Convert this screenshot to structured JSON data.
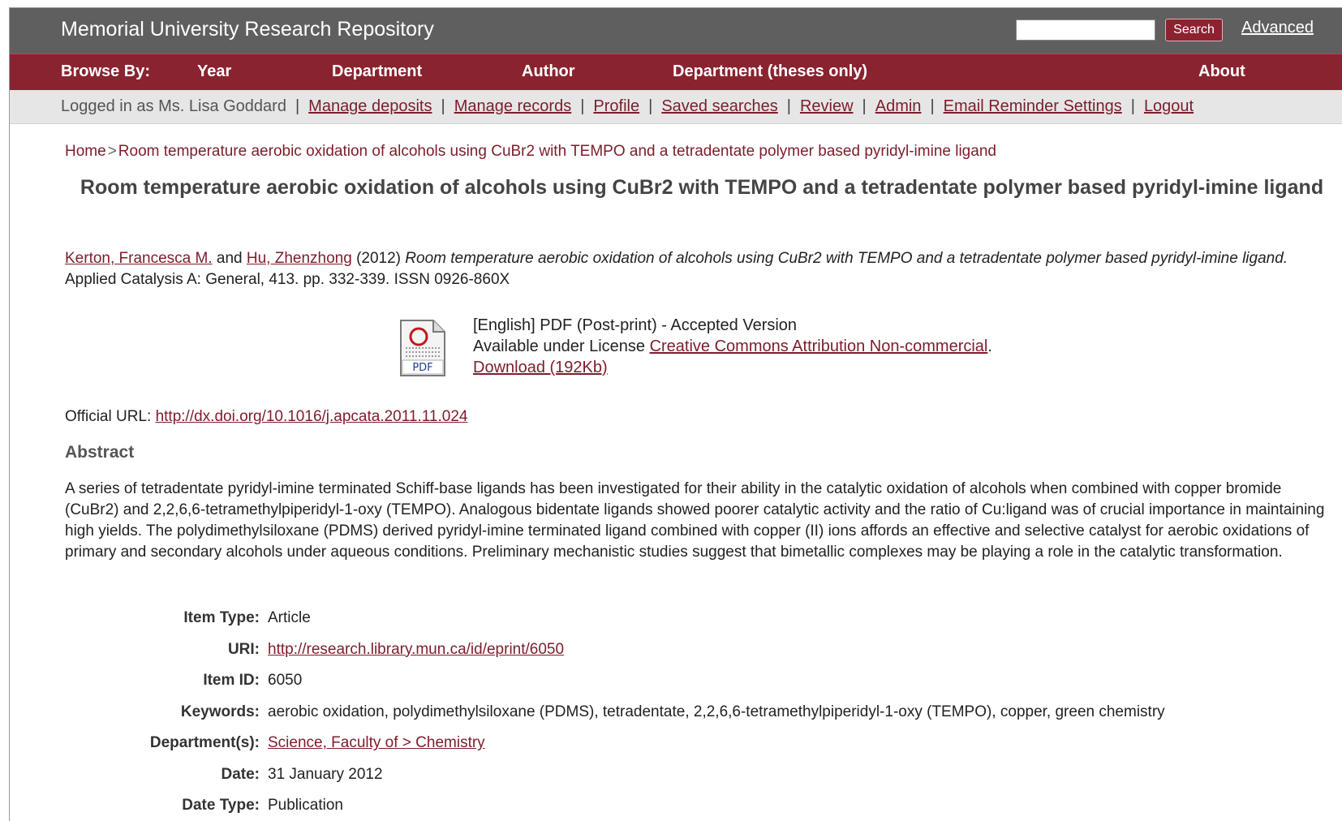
{
  "header": {
    "site_title": "Memorial University Research Repository",
    "search_button": "Search",
    "search_value": "",
    "advanced_link": "Advanced"
  },
  "browse": {
    "label": "Browse By:",
    "items": [
      "Year",
      "Department",
      "Author",
      "Department (theses only)"
    ],
    "about": "About"
  },
  "userbar": {
    "logged_in": "Logged in as Ms. Lisa Goddard",
    "links": [
      "Manage deposits",
      "Manage records",
      "Profile",
      "Saved searches",
      "Review",
      "Admin",
      "Email Reminder Settings",
      "Logout"
    ]
  },
  "breadcrumb": {
    "home": "Home",
    "separator": ">",
    "current": "Room temperature aerobic oxidation of alcohols using CuBr2 with TEMPO and a tetradentate polymer based pyridyl-imine ligand"
  },
  "item": {
    "title": "Room temperature aerobic oxidation of alcohols using CuBr2 with TEMPO and a tetradentate polymer based pyridyl-imine ligand",
    "citation": {
      "author1": "Kerton, Francesca M.",
      "and": " and ",
      "author2": "Hu, Zhenzhong",
      "year": " (2012) ",
      "title_italic": "Room temperature aerobic oxidation of alcohols using CuBr2 with TEMPO and a tetradentate polymer based pyridyl-imine ligand.",
      "rest": " Applied Catalysis A: General, 413. pp. 332-339. ISSN 0926-860X"
    },
    "document": {
      "icon_label": "PDF",
      "line1": "[English] PDF (Post-print) - Accepted Version",
      "license_prefix": "Available under License ",
      "license_link": "Creative Commons Attribution Non-commercial",
      "license_suffix": ".",
      "download": "Download (192Kb)"
    },
    "official_url_label": "Official URL: ",
    "official_url": "http://dx.doi.org/10.1016/j.apcata.2011.11.024",
    "abstract_heading": "Abstract",
    "abstract": "A series of tetradentate pyridyl-imine terminated Schiff-base ligands has been investigated for their ability in the catalytic oxidation of alcohols when combined with copper bromide (CuBr2) and 2,2,6,6-tetramethylpiperidyl-1-oxy (TEMPO). Analogous bidentate ligands showed poorer catalytic activity and the ratio of Cu:ligand was of crucial importance in maintaining high yields. The polydimethylsiloxane (PDMS) derived pyridyl-imine terminated ligand combined with copper (II) ions affords an effective and selective catalyst for aerobic oxidations of primary and secondary alcohols under aqueous conditions. Preliminary mechanistic studies suggest that bimetallic complexes may be playing a role in the catalytic transformation."
  },
  "metadata": {
    "item_type_label": "Item Type:",
    "item_type": "Article",
    "uri_label": "URI:",
    "uri": "http://research.library.mun.ca/id/eprint/6050",
    "item_id_label": "Item ID:",
    "item_id": "6050",
    "keywords_label": "Keywords:",
    "keywords": "aerobic oxidation, polydimethylsiloxane (PDMS), tetradentate, 2,2,6,6-tetramethylpiperidyl-1-oxy (TEMPO), copper, green chemistry",
    "department_label": "Department(s):",
    "department": "Science, Faculty of > Chemistry",
    "date_label": "Date:",
    "date": "31 January 2012",
    "date_type_label": "Date Type:",
    "date_type": "Publication"
  }
}
